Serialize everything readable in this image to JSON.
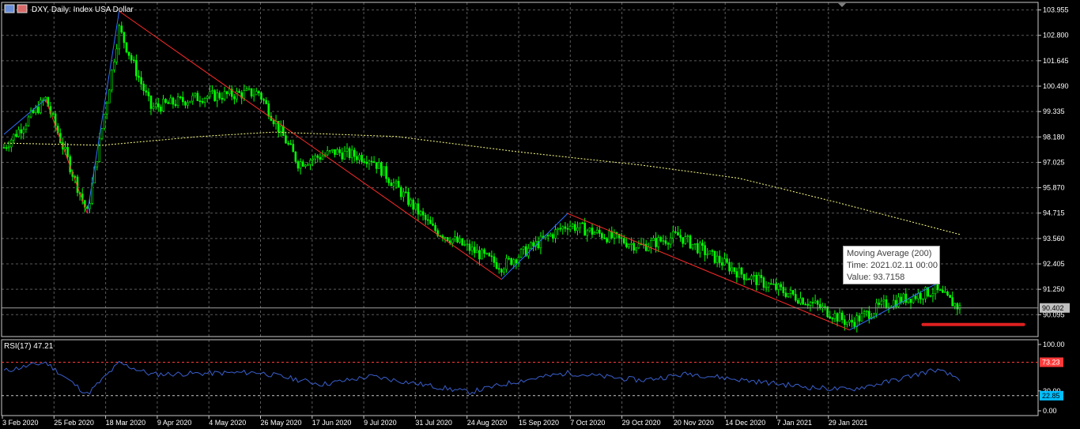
{
  "window": {
    "title": "DXY, Daily:  Index USA Dollar"
  },
  "colors": {
    "background": "#000000",
    "grid": "#5a5a5a",
    "bull": "#00ff00",
    "bear": "#00ff00",
    "zigzag_up": "#2f6fff",
    "zigzag_down": "#ff2a2a",
    "ma": "#ffff80",
    "rsi": "#3a5fcd",
    "rsi_high": "#ff3a3a",
    "rsi_low": "#00bfff",
    "current_price": "#a0a0a0",
    "marker": "#e02020"
  },
  "tooltip": {
    "line1": "Moving Average (200)",
    "line2": "Time: 2021.02.11 00:00",
    "line3": "Value: 93.7158"
  },
  "price_tag": "90.402",
  "rsi_title": "RSI(17) 47.21",
  "rsi_tags": {
    "high": "73.23",
    "low": "22.85"
  },
  "chart_data": [
    {
      "type": "candlestick",
      "title": "DXY, Daily:  Index USA Dollar",
      "y_ticks": [
        "103.955",
        "102.800",
        "101.645",
        "100.490",
        "99.335",
        "98.180",
        "97.025",
        "95.870",
        "94.715",
        "93.560",
        "92.405",
        "91.250",
        "90.095"
      ],
      "ylim": [
        89.1,
        104.3
      ],
      "x_ticks": [
        "3 Feb 2020",
        "25 Feb 2020",
        "18 Mar 2020",
        "9 Apr 2020",
        "4 May 2020",
        "26 May 2020",
        "17 Jun 2020",
        "9 Jul 2020",
        "31 Jul 2020",
        "24 Aug 2020",
        "15 Sep 2020",
        "7 Oct 2020",
        "29 Oct 2020",
        "20 Nov 2020",
        "14 Dec 2020",
        "7 Jan 2021",
        "29 Jan 2021"
      ],
      "close_anchors": [
        {
          "bar": 0,
          "value": 97.7
        },
        {
          "bar": 17,
          "value": 99.9
        },
        {
          "bar": 34,
          "value": 94.7
        },
        {
          "bar": 47,
          "value": 103.1
        },
        {
          "bar": 60,
          "value": 99.5
        },
        {
          "bar": 80,
          "value": 100.0
        },
        {
          "bar": 104,
          "value": 100.2
        },
        {
          "bar": 120,
          "value": 97.0
        },
        {
          "bar": 135,
          "value": 97.5
        },
        {
          "bar": 150,
          "value": 97.2
        },
        {
          "bar": 175,
          "value": 94.0
        },
        {
          "bar": 203,
          "value": 92.3
        },
        {
          "bar": 230,
          "value": 94.2
        },
        {
          "bar": 260,
          "value": 93.2
        },
        {
          "bar": 275,
          "value": 93.7
        },
        {
          "bar": 300,
          "value": 92.0
        },
        {
          "bar": 330,
          "value": 90.6
        },
        {
          "bar": 345,
          "value": 89.7
        },
        {
          "bar": 360,
          "value": 90.6
        },
        {
          "bar": 380,
          "value": 91.2
        },
        {
          "bar": 390,
          "value": 90.4
        }
      ],
      "current_price": 90.402,
      "zigzag": [
        {
          "bar": 0,
          "value": 98.3,
          "dir": "up"
        },
        {
          "bar": 17,
          "value": 99.9,
          "dir": "down"
        },
        {
          "bar": 34,
          "value": 94.7,
          "dir": "up"
        },
        {
          "bar": 47,
          "value": 103.9,
          "dir": "down"
        },
        {
          "bar": 203,
          "value": 91.7,
          "dir": "up"
        },
        {
          "bar": 230,
          "value": 94.7,
          "dir": "down"
        },
        {
          "bar": 345,
          "value": 89.4,
          "dir": "up"
        },
        {
          "bar": 382,
          "value": 91.6,
          "dir": "none"
        }
      ],
      "moving_average": {
        "name": "Moving Average (200)",
        "points": [
          {
            "bar": 0,
            "value": 97.9
          },
          {
            "bar": 40,
            "value": 97.8
          },
          {
            "bar": 80,
            "value": 98.2
          },
          {
            "bar": 110,
            "value": 98.4
          },
          {
            "bar": 160,
            "value": 98.2
          },
          {
            "bar": 210,
            "value": 97.5
          },
          {
            "bar": 260,
            "value": 96.9
          },
          {
            "bar": 300,
            "value": 96.3
          },
          {
            "bar": 340,
            "value": 95.2
          },
          {
            "bar": 391,
            "value": 93.7158
          }
        ]
      },
      "marker": {
        "bar_from": 375,
        "bar_to": 416,
        "value": 89.65
      }
    },
    {
      "type": "line",
      "title": "RSI(17) 47.21",
      "y_ticks": [
        "100.00",
        "30.00",
        "0.00"
      ],
      "ylim": [
        0,
        100
      ],
      "levels": [
        73.23,
        22.85
      ],
      "anchors": [
        {
          "bar": 0,
          "value": 60
        },
        {
          "bar": 17,
          "value": 73
        },
        {
          "bar": 34,
          "value": 25
        },
        {
          "bar": 47,
          "value": 72
        },
        {
          "bar": 60,
          "value": 55
        },
        {
          "bar": 104,
          "value": 58
        },
        {
          "bar": 130,
          "value": 40
        },
        {
          "bar": 150,
          "value": 52
        },
        {
          "bar": 190,
          "value": 28
        },
        {
          "bar": 210,
          "value": 45
        },
        {
          "bar": 230,
          "value": 57
        },
        {
          "bar": 260,
          "value": 46
        },
        {
          "bar": 280,
          "value": 56
        },
        {
          "bar": 300,
          "value": 47
        },
        {
          "bar": 330,
          "value": 35
        },
        {
          "bar": 345,
          "value": 32
        },
        {
          "bar": 360,
          "value": 43
        },
        {
          "bar": 380,
          "value": 62
        },
        {
          "bar": 391,
          "value": 47.21
        }
      ]
    }
  ]
}
